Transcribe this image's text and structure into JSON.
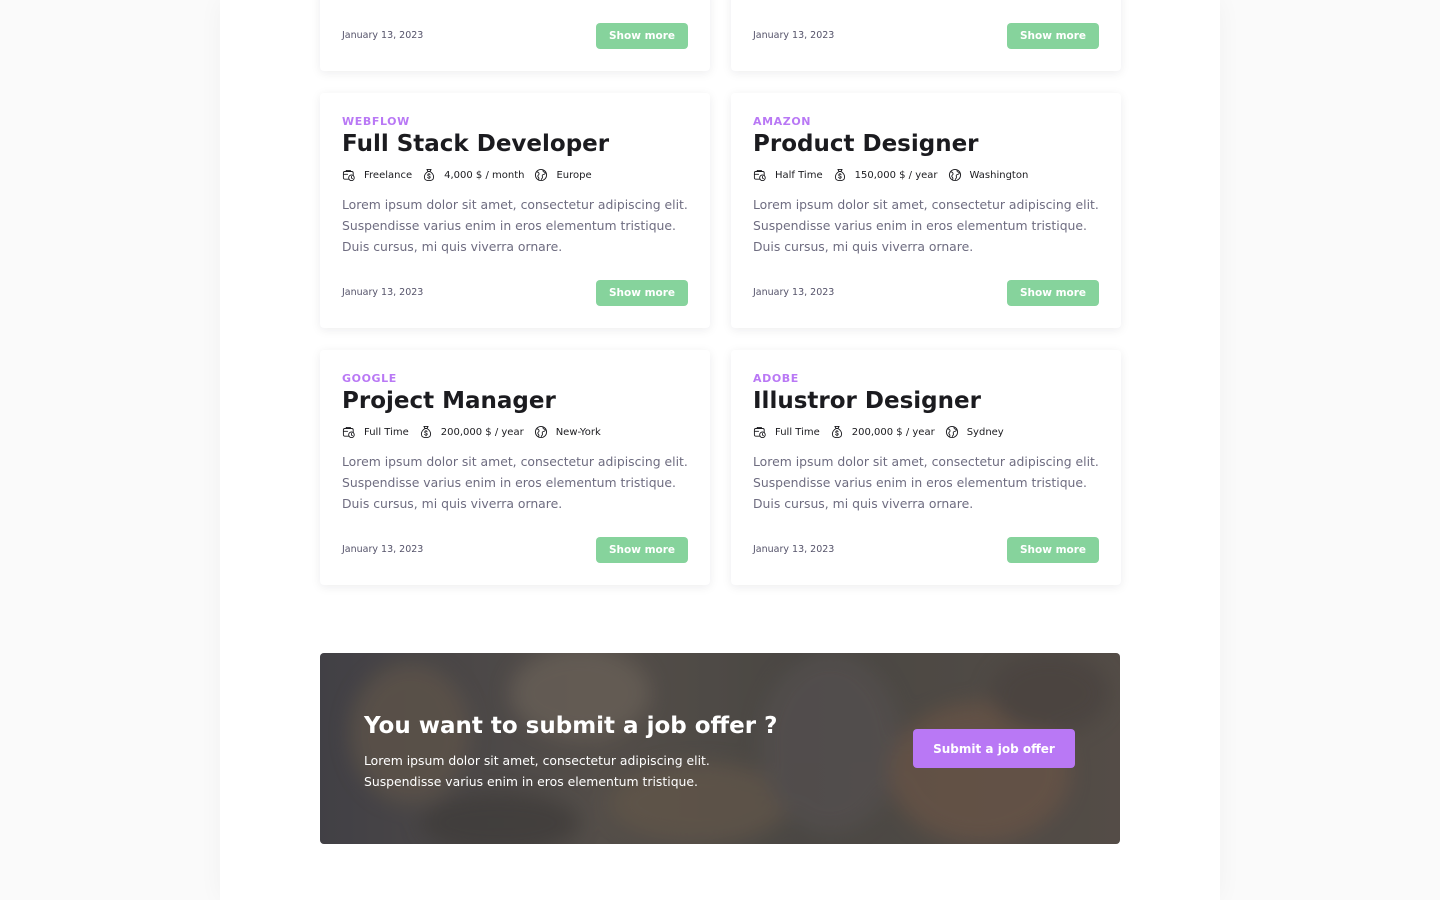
{
  "colors": {
    "accent": "#b978f5",
    "button_green": "#86d39c",
    "text_dark": "#1b1b1f",
    "text_muted": "#6e6c80"
  },
  "icons": {
    "contract": "calendar-clock-icon",
    "salary": "money-bag-icon",
    "location": "globe-icon"
  },
  "top_row": [
    {
      "date": "January 13, 2023",
      "button": "Show more"
    },
    {
      "date": "January 13, 2023",
      "button": "Show more"
    }
  ],
  "jobs": [
    {
      "company": "WEBFLOW",
      "title": "Full Stack Developer",
      "contract": "Freelance",
      "salary": "4,000 $ / month",
      "location": "Europe",
      "description": "Lorem ipsum dolor sit amet, consectetur adipiscing elit. Suspendisse varius enim in eros elementum tristique. Duis cursus, mi quis viverra ornare.",
      "date": "January 13, 2023",
      "button": "Show more"
    },
    {
      "company": "AMAZON",
      "title": "Product Designer",
      "contract": "Half Time",
      "salary": "150,000 $ / year",
      "location": "Washington",
      "description": "Lorem ipsum dolor sit amet, consectetur adipiscing elit. Suspendisse varius enim in eros elementum tristique. Duis cursus, mi quis viverra ornare.",
      "date": "January 13, 2023",
      "button": "Show more"
    },
    {
      "company": "GOOGLE",
      "title": "Project Manager",
      "contract": "Full Time",
      "salary": "200,000 $ / year",
      "location": "New-York",
      "description": "Lorem ipsum dolor sit amet, consectetur adipiscing elit. Suspendisse varius enim in eros elementum tristique. Duis cursus, mi quis viverra ornare.",
      "date": "January 13, 2023",
      "button": "Show more"
    },
    {
      "company": "ADOBE",
      "title": "Illustror Designer",
      "contract": "Full Time",
      "salary": "200,000 $ / year",
      "location": "Sydney",
      "description": "Lorem ipsum dolor sit amet, consectetur adipiscing elit. Suspendisse varius enim in eros elementum tristique. Duis cursus, mi quis viverra ornare.",
      "date": "January 13, 2023",
      "button": "Show more"
    }
  ],
  "cta": {
    "title": "You want to submit a job offer ?",
    "text": "Lorem ipsum dolor sit amet, consectetur adipiscing elit. Suspendisse varius enim in eros elementum tristique.",
    "button": "Submit a job offer"
  }
}
